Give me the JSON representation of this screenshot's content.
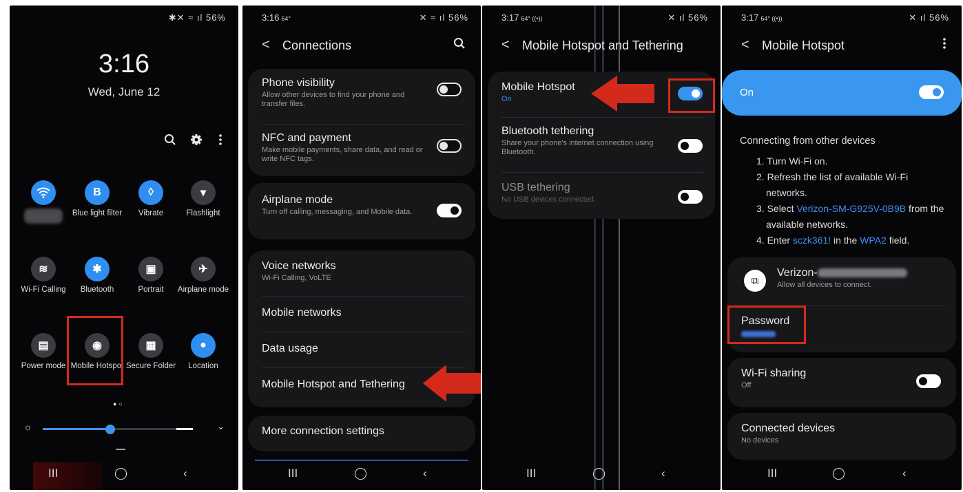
{
  "panel1": {
    "status_right": "✱✕ ≈ ıl 56%",
    "time": "3:16",
    "date": "Wed, June 12",
    "actions": [
      "search-icon",
      "gear-icon",
      "more-icon"
    ],
    "tiles": [
      {
        "label": "",
        "icon": "wifi-icon",
        "active": true
      },
      {
        "label": "Blue light filter",
        "icon": "blue-light-icon",
        "active": true
      },
      {
        "label": "Vibrate",
        "icon": "vibrate-icon",
        "active": true
      },
      {
        "label": "Flashlight",
        "icon": "flashlight-icon",
        "active": false
      },
      {
        "label": "Wi-Fi Calling",
        "icon": "wifi-calling-icon",
        "active": false
      },
      {
        "label": "Bluetooth",
        "icon": "bluetooth-icon",
        "active": true
      },
      {
        "label": "Portrait",
        "icon": "portrait-icon",
        "active": false
      },
      {
        "label": "Airplane mode",
        "icon": "airplane-icon",
        "active": false
      },
      {
        "label": "Power mode",
        "icon": "power-mode-icon",
        "active": false
      },
      {
        "label": "Mobile Hotspot",
        "icon": "mobile-hotspot-icon",
        "active": false
      },
      {
        "label": "Secure Folder",
        "icon": "secure-folder-icon",
        "active": false
      },
      {
        "label": "Location",
        "icon": "location-icon",
        "active": true
      }
    ],
    "brightness_level": 0.45
  },
  "panel2": {
    "status_left": "3:16",
    "status_extra": "64°",
    "status_right": "✕ ≈ ıl 56%",
    "title": "Connections",
    "phone_visibility": {
      "label": "Phone visibility",
      "sub": "Allow other devices to find your phone and transfer files."
    },
    "nfc": {
      "label": "NFC and payment",
      "sub": "Make mobile payments, share data, and read or write NFC tags."
    },
    "airplane": {
      "label": "Airplane mode",
      "sub": "Turn off calling, messaging, and Mobile data."
    },
    "voice": {
      "label": "Voice networks",
      "sub": "Wi-Fi Calling, VoLTE"
    },
    "mobile_networks": "Mobile networks",
    "data_usage": "Data usage",
    "hotspot_tethering": "Mobile Hotspot and Tethering",
    "more": "More connection settings"
  },
  "panel3": {
    "status_left": "3:17",
    "status_extra": "64° ((•))",
    "status_right": "✕ ıl 56%",
    "title": "Mobile Hotspot and Tethering",
    "hotspot": {
      "label": "Mobile Hotspot",
      "sub": "On"
    },
    "bt": {
      "label": "Bluetooth tethering",
      "sub": "Share your phone's internet connection using Bluetooth."
    },
    "usb": {
      "label": "USB tethering",
      "sub": "No USB devices connected."
    }
  },
  "panel4": {
    "status_left": "3:17",
    "status_extra": "64° ((•))",
    "status_right": "✕ ıl 56%",
    "title": "Mobile Hotspot",
    "on_label": "On",
    "instructions_title": "Connecting from other devices",
    "step1": "1. Turn Wi-Fi on.",
    "step2": "2. Refresh the list of available Wi-Fi networks.",
    "step3_a": "3. Select ",
    "step3_link": "Verizon-SM-G925V-0B9B",
    "step3_b": " from the available networks.",
    "step4_a": "4. Enter ",
    "step4_pw": "sczk361!",
    "step4_b": " in the ",
    "step4_wpa": "WPA2",
    "step4_c": " field.",
    "network_name": "Verizon-",
    "network_sub": "Allow all devices to connect.",
    "password_label": "Password",
    "wifi_sharing": {
      "label": "Wi-Fi sharing",
      "sub": "Off"
    },
    "connected": {
      "label": "Connected devices",
      "sub": "No devices"
    }
  },
  "nav": {
    "recents": "III",
    "home": "◯",
    "back": "‹"
  },
  "colors": {
    "accent": "#3a93f1",
    "highlight": "#d42a1c",
    "background": "#060608"
  }
}
